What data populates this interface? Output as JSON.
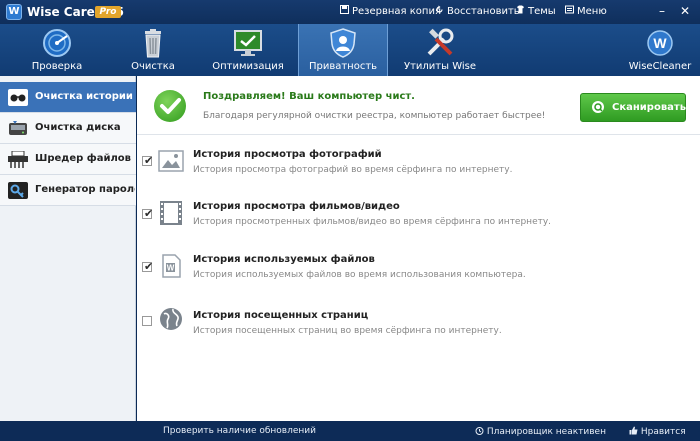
{
  "window": {
    "app_name": "Wise Care 365",
    "edition_badge": "Pro",
    "logo_letter": "W",
    "menu": [
      {
        "icon": "save-icon",
        "label": "Резервная копия"
      },
      {
        "icon": "restore-icon",
        "label": "Восстановить"
      },
      {
        "icon": "shirt-icon",
        "label": "Темы"
      },
      {
        "icon": "menu-icon",
        "label": "Меню"
      }
    ],
    "controls": {
      "minimize": "–",
      "close": "✕"
    }
  },
  "toolbar": {
    "items": [
      {
        "icon": "radar-icon",
        "label": "Проверка"
      },
      {
        "icon": "trash-icon",
        "label": "Очистка"
      },
      {
        "icon": "monitor-optimize-icon",
        "label": "Оптимизация"
      },
      {
        "icon": "privacy-shield-icon",
        "label": "Приватность",
        "active": true
      },
      {
        "icon": "tools-icon",
        "label": "Утилиты Wise"
      }
    ],
    "brand": {
      "logo_letter": "W",
      "label": "WiseCleaner"
    }
  },
  "sidebar": {
    "items": [
      {
        "icon": "glasses-icon",
        "label": "Очистка истории",
        "active": true
      },
      {
        "icon": "disk-icon",
        "label": "Очистка диска"
      },
      {
        "icon": "shredder-icon",
        "label": "Шредер файлов"
      },
      {
        "icon": "key-icon",
        "label": "Генератор паролей"
      }
    ]
  },
  "banner": {
    "title": "Поздравляем! Ваш компьютер чист.",
    "subtitle": "Благодаря регулярной очистки реестра, компьютер работает быстрее!",
    "scan_button": "Сканировать",
    "colors": {
      "accent_green": "#2f9b22",
      "title_green": "#2a7a1a"
    }
  },
  "history_items": [
    {
      "icon": "photo-icon",
      "checked": true,
      "title": "История просмотра фотографий",
      "description": "История просмотра фотографий во время сёрфинга по интернету."
    },
    {
      "icon": "film-icon",
      "checked": true,
      "title": "История просмотра фильмов/видео",
      "description": "История просмотренных фильмов/видео во время сёрфинга по интернету."
    },
    {
      "icon": "document-icon",
      "checked": true,
      "title": "История используемых файлов",
      "description": "История используемых файлов во время использования компьютера."
    },
    {
      "icon": "globe-icon",
      "checked": false,
      "title": "История посещенных страниц",
      "description": "История посещенных страниц во время сёрфинга по интернету."
    }
  ],
  "statusbar": {
    "update_link": "Проверить наличие обновлений",
    "scheduler": "Планировщик неактивен",
    "like": "Нравится"
  },
  "checkmark_glyph": "✔"
}
